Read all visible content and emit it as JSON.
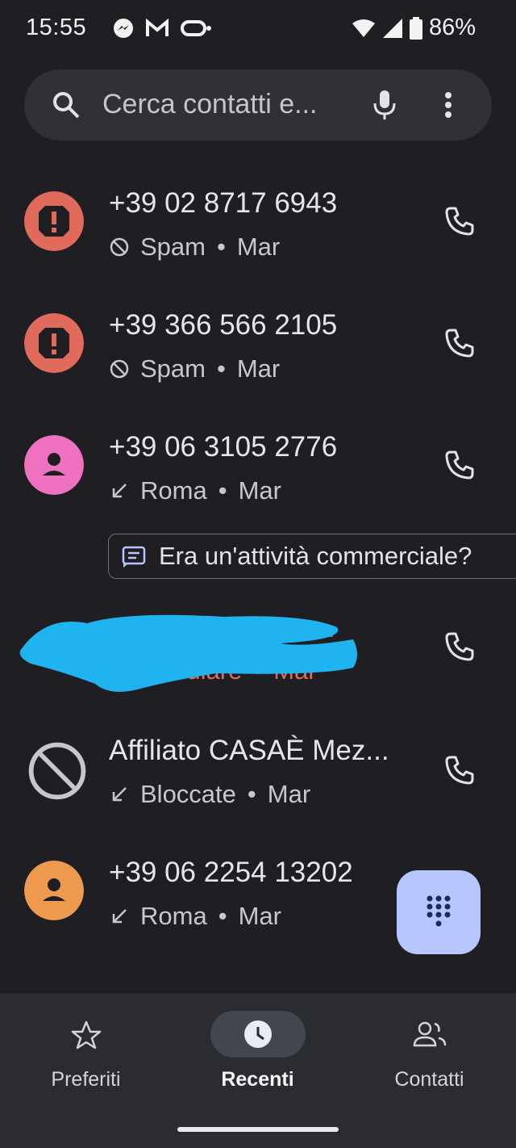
{
  "status_bar": {
    "time": "15:55",
    "battery": "86%",
    "icons": [
      "messenger-icon",
      "gmail-icon",
      "voicemail-icon",
      "dot-icon",
      "wifi-icon",
      "signal-icon",
      "battery-icon"
    ]
  },
  "search": {
    "placeholder": "Cerca contatti e..."
  },
  "calls": [
    {
      "number": "+39 02 8717 6943",
      "status": "Spam",
      "day": "Mar",
      "avatar": "spam-icon",
      "avatar_color": "#e06b5c"
    },
    {
      "number": "+39 366 566 2105",
      "status": "Spam",
      "day": "Mar",
      "avatar": "spam-icon",
      "avatar_color": "#e06b5c"
    },
    {
      "number": "+39 06 3105 2776",
      "status": "Roma",
      "day": "Mar",
      "avatar": "person-icon",
      "avatar_color": "#ef72c0"
    },
    {
      "number": "",
      "status": "Cellulare",
      "day": "Mar",
      "avatar": "photo",
      "avatar_color": "#4b4b4b"
    },
    {
      "number": "Affiliato CASAÈ Mez...",
      "status": "Bloccate",
      "day": "Mar",
      "avatar": "blocked-icon",
      "avatar_color": "#c6c6cc"
    },
    {
      "number": "+39 06 2254 13202",
      "status": "Roma",
      "day": "Mar",
      "avatar": "person-icon",
      "avatar_color": "#ed9a4f"
    }
  ],
  "business_prompt": "Era un'attività commerciale?",
  "nav": {
    "favorites": "Preferiti",
    "recents": "Recenti",
    "contacts": "Contatti"
  },
  "colors": {
    "background": "#1f1f23",
    "accent": "#b7c6ff",
    "missed": "#e06b5c"
  }
}
